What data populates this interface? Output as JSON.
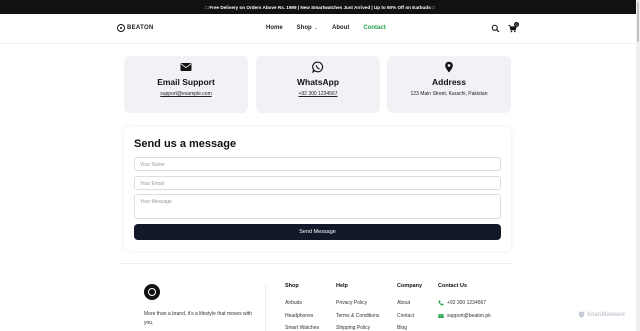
{
  "announcement": "□ Free Delivery on Orders Above Rs. 1999 | New Smartwatches Just Arrived | Up to 50% Off on Earbuds □",
  "brand": {
    "name": "BEATON"
  },
  "nav": {
    "home": "Home",
    "shop": "Shop",
    "about": "About",
    "contact": "Contact",
    "active_color": "#22a04b"
  },
  "header_icons": {
    "search": "search-icon",
    "cart": "cart-icon",
    "cart_count": "0"
  },
  "contact_cards": [
    {
      "icon": "envelope-icon",
      "title": "Email Support",
      "value": "support@example.com"
    },
    {
      "icon": "whatsapp-icon",
      "title": "WhatsApp",
      "value": "+92 300 1234567"
    },
    {
      "icon": "map-pin-icon",
      "title": "Address",
      "value": "123 Main Street, Karachi, Pakistan"
    }
  ],
  "form": {
    "title": "Send us a message",
    "name_placeholder": "Your Name",
    "email_placeholder": "Your Email",
    "message_placeholder": "Your Message",
    "submit_label": "Send Message",
    "submit_color": "#121828"
  },
  "footer": {
    "description": "More than a brand, it's a lifestyle that moves with you.",
    "shop": {
      "heading": "Shop",
      "items": [
        "Airbuds",
        "Headphones",
        "Smart Watches"
      ]
    },
    "help": {
      "heading": "Help",
      "items": [
        "Privacy Policy",
        "Terms & Conditions",
        "Shipping Policy"
      ]
    },
    "company": {
      "heading": "Company",
      "items": [
        "About",
        "Contact",
        "Blog"
      ]
    },
    "contact": {
      "heading": "Contact Us",
      "phone": "+92 300 1234567",
      "email": "support@beaton.pk",
      "icon_color": "#22a04b"
    }
  },
  "watermark": "ScanMalware"
}
